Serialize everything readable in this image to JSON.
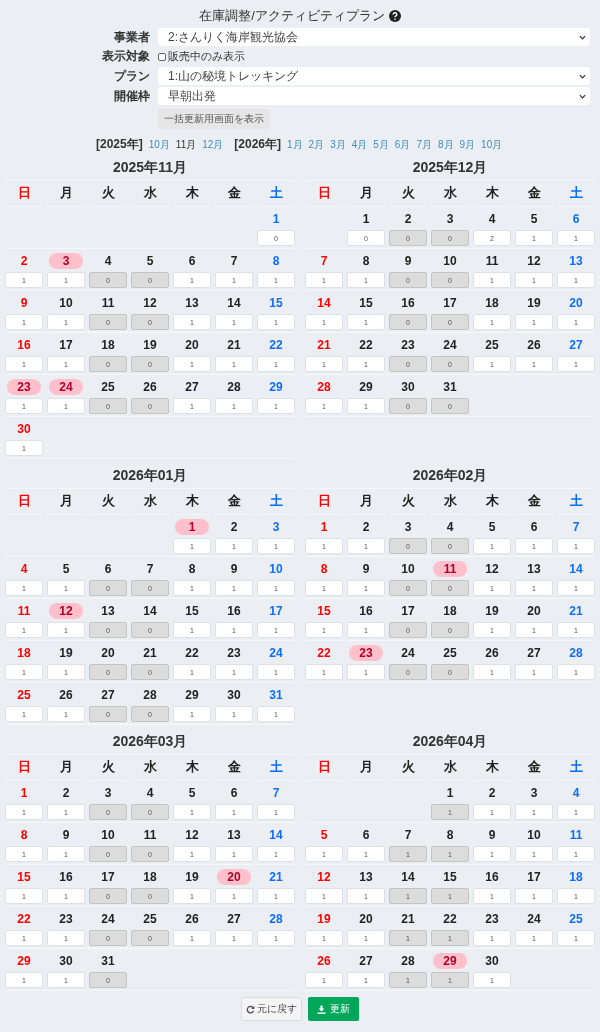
{
  "title": {
    "text": "在庫調整/アクティビティプラン"
  },
  "form": [
    {
      "kind": "select",
      "label": "事業者",
      "value": "2:さんりく海岸観光協会"
    },
    {
      "kind": "checkbox",
      "label": "表示対象",
      "text": "販売中のみ表示",
      "checked": false
    },
    {
      "kind": "select",
      "label": "プラン",
      "value": "1:山の秘境トレッキング"
    },
    {
      "kind": "select",
      "label": "開催枠",
      "value": "早朝出発"
    }
  ],
  "bulk_button": "一括更新用画面を表示",
  "year_nav": [
    {
      "year": "[2025年]",
      "months": [
        {
          "label": "10月",
          "selected": false
        },
        {
          "label": "11月",
          "selected": true
        },
        {
          "label": "12月",
          "selected": false
        }
      ]
    },
    {
      "year": "[2026年]",
      "months": [
        {
          "label": "1月",
          "selected": false
        },
        {
          "label": "2月",
          "selected": false
        },
        {
          "label": "3月",
          "selected": false
        },
        {
          "label": "4月",
          "selected": false
        },
        {
          "label": "5月",
          "selected": false
        },
        {
          "label": "6月",
          "selected": false
        },
        {
          "label": "7月",
          "selected": false
        },
        {
          "label": "8月",
          "selected": false
        },
        {
          "label": "9月",
          "selected": false
        },
        {
          "label": "10月",
          "selected": false
        }
      ]
    }
  ],
  "months": [
    {
      "title": "2025年11月",
      "weekdays": [
        "日",
        "月",
        "火",
        "水",
        "木",
        "金",
        "土"
      ],
      "weeks": [
        [
          {
            "day": "1",
            "count": "0",
            "closed": false,
            "holiday": false
          }
        ],
        [
          {
            "day": "2",
            "count": "1",
            "closed": false,
            "holiday": false
          },
          {
            "day": "3",
            "count": "1",
            "closed": false,
            "holiday": true
          },
          {
            "day": "4",
            "count": "0",
            "closed": true,
            "holiday": false
          },
          {
            "day": "5",
            "count": "0",
            "closed": true,
            "holiday": false
          },
          {
            "day": "6",
            "count": "1",
            "closed": false,
            "holiday": false
          },
          {
            "day": "7",
            "count": "1",
            "closed": false,
            "holiday": false
          },
          {
            "day": "8",
            "count": "1",
            "closed": false,
            "holiday": false
          }
        ],
        [
          {
            "day": "9",
            "count": "1",
            "closed": false,
            "holiday": false
          },
          {
            "day": "10",
            "count": "1",
            "closed": false,
            "holiday": false
          },
          {
            "day": "11",
            "count": "0",
            "closed": true,
            "holiday": false
          },
          {
            "day": "12",
            "count": "0",
            "closed": true,
            "holiday": false
          },
          {
            "day": "13",
            "count": "1",
            "closed": false,
            "holiday": false
          },
          {
            "day": "14",
            "count": "1",
            "closed": false,
            "holiday": false
          },
          {
            "day": "15",
            "count": "1",
            "closed": false,
            "holiday": false
          }
        ],
        [
          {
            "day": "16",
            "count": "1",
            "closed": false,
            "holiday": false
          },
          {
            "day": "17",
            "count": "1",
            "closed": false,
            "holiday": false
          },
          {
            "day": "18",
            "count": "0",
            "closed": true,
            "holiday": false
          },
          {
            "day": "19",
            "count": "0",
            "closed": true,
            "holiday": false
          },
          {
            "day": "20",
            "count": "1",
            "closed": false,
            "holiday": false
          },
          {
            "day": "21",
            "count": "1",
            "closed": false,
            "holiday": false
          },
          {
            "day": "22",
            "count": "1",
            "closed": false,
            "holiday": false
          }
        ],
        [
          {
            "day": "23",
            "count": "1",
            "closed": false,
            "holiday": true
          },
          {
            "day": "24",
            "count": "1",
            "closed": false,
            "holiday": true
          },
          {
            "day": "25",
            "count": "0",
            "closed": true,
            "holiday": false
          },
          {
            "day": "26",
            "count": "0",
            "closed": true,
            "holiday": false
          },
          {
            "day": "27",
            "count": "1",
            "closed": false,
            "holiday": false
          },
          {
            "day": "28",
            "count": "1",
            "closed": false,
            "holiday": false
          },
          {
            "day": "29",
            "count": "1",
            "closed": false,
            "holiday": false
          }
        ],
        [
          {
            "day": "30",
            "count": "1",
            "closed": false,
            "holiday": false
          }
        ]
      ]
    },
    {
      "title": "2025年12月",
      "weekdays": [
        "日",
        "月",
        "火",
        "水",
        "木",
        "金",
        "土"
      ],
      "weeks": [
        [
          {
            "day": "1",
            "count": "0",
            "closed": false,
            "holiday": false
          },
          {
            "day": "2",
            "count": "0",
            "closed": true,
            "holiday": false
          },
          {
            "day": "3",
            "count": "0",
            "closed": true,
            "holiday": false
          },
          {
            "day": "4",
            "count": "2",
            "closed": false,
            "holiday": false
          },
          {
            "day": "5",
            "count": "1",
            "closed": false,
            "holiday": false
          },
          {
            "day": "6",
            "count": "1",
            "closed": false,
            "holiday": false
          }
        ],
        [
          {
            "day": "7",
            "count": "1",
            "closed": false,
            "holiday": false
          },
          {
            "day": "8",
            "count": "1",
            "closed": false,
            "holiday": false
          },
          {
            "day": "9",
            "count": "0",
            "closed": true,
            "holiday": false
          },
          {
            "day": "10",
            "count": "0",
            "closed": true,
            "holiday": false
          },
          {
            "day": "11",
            "count": "1",
            "closed": false,
            "holiday": false
          },
          {
            "day": "12",
            "count": "1",
            "closed": false,
            "holiday": false
          },
          {
            "day": "13",
            "count": "1",
            "closed": false,
            "holiday": false
          }
        ],
        [
          {
            "day": "14",
            "count": "1",
            "closed": false,
            "holiday": false
          },
          {
            "day": "15",
            "count": "1",
            "closed": false,
            "holiday": false
          },
          {
            "day": "16",
            "count": "0",
            "closed": true,
            "holiday": false
          },
          {
            "day": "17",
            "count": "0",
            "closed": true,
            "holiday": false
          },
          {
            "day": "18",
            "count": "1",
            "closed": false,
            "holiday": false
          },
          {
            "day": "19",
            "count": "1",
            "closed": false,
            "holiday": false
          },
          {
            "day": "20",
            "count": "1",
            "closed": false,
            "holiday": false
          }
        ],
        [
          {
            "day": "21",
            "count": "1",
            "closed": false,
            "holiday": false
          },
          {
            "day": "22",
            "count": "1",
            "closed": false,
            "holiday": false
          },
          {
            "day": "23",
            "count": "0",
            "closed": true,
            "holiday": false
          },
          {
            "day": "24",
            "count": "0",
            "closed": true,
            "holiday": false
          },
          {
            "day": "25",
            "count": "1",
            "closed": false,
            "holiday": false
          },
          {
            "day": "26",
            "count": "1",
            "closed": false,
            "holiday": false
          },
          {
            "day": "27",
            "count": "1",
            "closed": false,
            "holiday": false
          }
        ],
        [
          {
            "day": "28",
            "count": "1",
            "closed": false,
            "holiday": false
          },
          {
            "day": "29",
            "count": "1",
            "closed": false,
            "holiday": false
          },
          {
            "day": "30",
            "count": "0",
            "closed": true,
            "holiday": false
          },
          {
            "day": "31",
            "count": "0",
            "closed": true,
            "holiday": false
          }
        ]
      ]
    },
    {
      "title": "2026年01月",
      "weekdays": [
        "日",
        "月",
        "火",
        "水",
        "木",
        "金",
        "土"
      ],
      "weeks": [
        [
          {
            "day": "1",
            "count": "1",
            "closed": false,
            "holiday": true
          },
          {
            "day": "2",
            "count": "1",
            "closed": false,
            "holiday": false
          },
          {
            "day": "3",
            "count": "1",
            "closed": false,
            "holiday": false
          }
        ],
        [
          {
            "day": "4",
            "count": "1",
            "closed": false,
            "holiday": false
          },
          {
            "day": "5",
            "count": "1",
            "closed": false,
            "holiday": false
          },
          {
            "day": "6",
            "count": "0",
            "closed": true,
            "holiday": false
          },
          {
            "day": "7",
            "count": "0",
            "closed": true,
            "holiday": false
          },
          {
            "day": "8",
            "count": "1",
            "closed": false,
            "holiday": false
          },
          {
            "day": "9",
            "count": "1",
            "closed": false,
            "holiday": false
          },
          {
            "day": "10",
            "count": "1",
            "closed": false,
            "holiday": false
          }
        ],
        [
          {
            "day": "11",
            "count": "1",
            "closed": false,
            "holiday": false
          },
          {
            "day": "12",
            "count": "1",
            "closed": false,
            "holiday": true
          },
          {
            "day": "13",
            "count": "0",
            "closed": true,
            "holiday": false
          },
          {
            "day": "14",
            "count": "0",
            "closed": true,
            "holiday": false
          },
          {
            "day": "15",
            "count": "1",
            "closed": false,
            "holiday": false
          },
          {
            "day": "16",
            "count": "1",
            "closed": false,
            "holiday": false
          },
          {
            "day": "17",
            "count": "1",
            "closed": false,
            "holiday": false
          }
        ],
        [
          {
            "day": "18",
            "count": "1",
            "closed": false,
            "holiday": false
          },
          {
            "day": "19",
            "count": "1",
            "closed": false,
            "holiday": false
          },
          {
            "day": "20",
            "count": "0",
            "closed": true,
            "holiday": false
          },
          {
            "day": "21",
            "count": "0",
            "closed": true,
            "holiday": false
          },
          {
            "day": "22",
            "count": "1",
            "closed": false,
            "holiday": false
          },
          {
            "day": "23",
            "count": "1",
            "closed": false,
            "holiday": false
          },
          {
            "day": "24",
            "count": "1",
            "closed": false,
            "holiday": false
          }
        ],
        [
          {
            "day": "25",
            "count": "1",
            "closed": false,
            "holiday": false
          },
          {
            "day": "26",
            "count": "1",
            "closed": false,
            "holiday": false
          },
          {
            "day": "27",
            "count": "0",
            "closed": true,
            "holiday": false
          },
          {
            "day": "28",
            "count": "0",
            "closed": true,
            "holiday": false
          },
          {
            "day": "29",
            "count": "1",
            "closed": false,
            "holiday": false
          },
          {
            "day": "30",
            "count": "1",
            "closed": false,
            "holiday": false
          },
          {
            "day": "31",
            "count": "1",
            "closed": false,
            "holiday": false
          }
        ]
      ]
    },
    {
      "title": "2026年02月",
      "weekdays": [
        "日",
        "月",
        "火",
        "水",
        "木",
        "金",
        "土"
      ],
      "weeks": [
        [
          {
            "day": "1",
            "count": "1",
            "closed": false,
            "holiday": false
          },
          {
            "day": "2",
            "count": "1",
            "closed": false,
            "holiday": false
          },
          {
            "day": "3",
            "count": "0",
            "closed": true,
            "holiday": false
          },
          {
            "day": "4",
            "count": "0",
            "closed": true,
            "holiday": false
          },
          {
            "day": "5",
            "count": "1",
            "closed": false,
            "holiday": false
          },
          {
            "day": "6",
            "count": "1",
            "closed": false,
            "holiday": false
          },
          {
            "day": "7",
            "count": "1",
            "closed": false,
            "holiday": false
          }
        ],
        [
          {
            "day": "8",
            "count": "1",
            "closed": false,
            "holiday": false
          },
          {
            "day": "9",
            "count": "1",
            "closed": false,
            "holiday": false
          },
          {
            "day": "10",
            "count": "0",
            "closed": true,
            "holiday": false
          },
          {
            "day": "11",
            "count": "0",
            "closed": true,
            "holiday": true
          },
          {
            "day": "12",
            "count": "1",
            "closed": false,
            "holiday": false
          },
          {
            "day": "13",
            "count": "1",
            "closed": false,
            "holiday": false
          },
          {
            "day": "14",
            "count": "1",
            "closed": false,
            "holiday": false
          }
        ],
        [
          {
            "day": "15",
            "count": "1",
            "closed": false,
            "holiday": false
          },
          {
            "day": "16",
            "count": "1",
            "closed": false,
            "holiday": false
          },
          {
            "day": "17",
            "count": "0",
            "closed": true,
            "holiday": false
          },
          {
            "day": "18",
            "count": "0",
            "closed": true,
            "holiday": false
          },
          {
            "day": "19",
            "count": "1",
            "closed": false,
            "holiday": false
          },
          {
            "day": "20",
            "count": "1",
            "closed": false,
            "holiday": false
          },
          {
            "day": "21",
            "count": "1",
            "closed": false,
            "holiday": false
          }
        ],
        [
          {
            "day": "22",
            "count": "1",
            "closed": false,
            "holiday": false
          },
          {
            "day": "23",
            "count": "1",
            "closed": false,
            "holiday": true
          },
          {
            "day": "24",
            "count": "0",
            "closed": true,
            "holiday": false
          },
          {
            "day": "25",
            "count": "0",
            "closed": true,
            "holiday": false
          },
          {
            "day": "26",
            "count": "1",
            "closed": false,
            "holiday": false
          },
          {
            "day": "27",
            "count": "1",
            "closed": false,
            "holiday": false
          },
          {
            "day": "28",
            "count": "1",
            "closed": false,
            "holiday": false
          }
        ]
      ]
    },
    {
      "title": "2026年03月",
      "weekdays": [
        "日",
        "月",
        "火",
        "水",
        "木",
        "金",
        "土"
      ],
      "weeks": [
        [
          {
            "day": "1",
            "count": "1",
            "closed": false,
            "holiday": false
          },
          {
            "day": "2",
            "count": "1",
            "closed": false,
            "holiday": false
          },
          {
            "day": "3",
            "count": "0",
            "closed": true,
            "holiday": false
          },
          {
            "day": "4",
            "count": "0",
            "closed": true,
            "holiday": false
          },
          {
            "day": "5",
            "count": "1",
            "closed": false,
            "holiday": false
          },
          {
            "day": "6",
            "count": "1",
            "closed": false,
            "holiday": false
          },
          {
            "day": "7",
            "count": "1",
            "closed": false,
            "holiday": false
          }
        ],
        [
          {
            "day": "8",
            "count": "1",
            "closed": false,
            "holiday": false
          },
          {
            "day": "9",
            "count": "1",
            "closed": false,
            "holiday": false
          },
          {
            "day": "10",
            "count": "0",
            "closed": true,
            "holiday": false
          },
          {
            "day": "11",
            "count": "0",
            "closed": true,
            "holiday": false
          },
          {
            "day": "12",
            "count": "1",
            "closed": false,
            "holiday": false
          },
          {
            "day": "13",
            "count": "1",
            "closed": false,
            "holiday": false
          },
          {
            "day": "14",
            "count": "1",
            "closed": false,
            "holiday": false
          }
        ],
        [
          {
            "day": "15",
            "count": "1",
            "closed": false,
            "holiday": false
          },
          {
            "day": "16",
            "count": "1",
            "closed": false,
            "holiday": false
          },
          {
            "day": "17",
            "count": "0",
            "closed": true,
            "holiday": false
          },
          {
            "day": "18",
            "count": "0",
            "closed": true,
            "holiday": false
          },
          {
            "day": "19",
            "count": "1",
            "closed": false,
            "holiday": false
          },
          {
            "day": "20",
            "count": "1",
            "closed": false,
            "holiday": true
          },
          {
            "day": "21",
            "count": "1",
            "closed": false,
            "holiday": false
          }
        ],
        [
          {
            "day": "22",
            "count": "1",
            "closed": false,
            "holiday": false
          },
          {
            "day": "23",
            "count": "1",
            "closed": false,
            "holiday": false
          },
          {
            "day": "24",
            "count": "0",
            "closed": true,
            "holiday": false
          },
          {
            "day": "25",
            "count": "0",
            "closed": true,
            "holiday": false
          },
          {
            "day": "26",
            "count": "1",
            "closed": false,
            "holiday": false
          },
          {
            "day": "27",
            "count": "1",
            "closed": false,
            "holiday": false
          },
          {
            "day": "28",
            "count": "1",
            "closed": false,
            "holiday": false
          }
        ],
        [
          {
            "day": "29",
            "count": "1",
            "closed": false,
            "holiday": false
          },
          {
            "day": "30",
            "count": "1",
            "closed": false,
            "holiday": false
          },
          {
            "day": "31",
            "count": "0",
            "closed": true,
            "holiday": false
          }
        ]
      ]
    },
    {
      "title": "2026年04月",
      "weekdays": [
        "日",
        "月",
        "火",
        "水",
        "木",
        "金",
        "土"
      ],
      "weeks": [
        [
          {
            "day": "1",
            "count": "1",
            "closed": true,
            "holiday": false
          },
          {
            "day": "2",
            "count": "1",
            "closed": false,
            "holiday": false
          },
          {
            "day": "3",
            "count": "1",
            "closed": false,
            "holiday": false
          },
          {
            "day": "4",
            "count": "1",
            "closed": false,
            "holiday": false
          }
        ],
        [
          {
            "day": "5",
            "count": "1",
            "closed": false,
            "holiday": false
          },
          {
            "day": "6",
            "count": "1",
            "closed": false,
            "holiday": false
          },
          {
            "day": "7",
            "count": "1",
            "closed": true,
            "holiday": false
          },
          {
            "day": "8",
            "count": "1",
            "closed": true,
            "holiday": false
          },
          {
            "day": "9",
            "count": "1",
            "closed": false,
            "holiday": false
          },
          {
            "day": "10",
            "count": "1",
            "closed": false,
            "holiday": false
          },
          {
            "day": "11",
            "count": "1",
            "closed": false,
            "holiday": false
          }
        ],
        [
          {
            "day": "12",
            "count": "1",
            "closed": false,
            "holiday": false
          },
          {
            "day": "13",
            "count": "1",
            "closed": false,
            "holiday": false
          },
          {
            "day": "14",
            "count": "1",
            "closed": true,
            "holiday": false
          },
          {
            "day": "15",
            "count": "1",
            "closed": true,
            "holiday": false
          },
          {
            "day": "16",
            "count": "1",
            "closed": false,
            "holiday": false
          },
          {
            "day": "17",
            "count": "1",
            "closed": false,
            "holiday": false
          },
          {
            "day": "18",
            "count": "1",
            "closed": false,
            "holiday": false
          }
        ],
        [
          {
            "day": "19",
            "count": "1",
            "closed": false,
            "holiday": false
          },
          {
            "day": "20",
            "count": "1",
            "closed": false,
            "holiday": false
          },
          {
            "day": "21",
            "count": "1",
            "closed": true,
            "holiday": false
          },
          {
            "day": "22",
            "count": "1",
            "closed": true,
            "holiday": false
          },
          {
            "day": "23",
            "count": "1",
            "closed": false,
            "holiday": false
          },
          {
            "day": "24",
            "count": "1",
            "closed": false,
            "holiday": false
          },
          {
            "day": "25",
            "count": "1",
            "closed": false,
            "holiday": false
          }
        ],
        [
          {
            "day": "26",
            "count": "1",
            "closed": false,
            "holiday": false
          },
          {
            "day": "27",
            "count": "1",
            "closed": false,
            "holiday": false
          },
          {
            "day": "28",
            "count": "1",
            "closed": true,
            "holiday": false
          },
          {
            "day": "29",
            "count": "1",
            "closed": true,
            "holiday": true
          },
          {
            "day": "30",
            "count": "1",
            "closed": false,
            "holiday": false
          }
        ]
      ]
    }
  ],
  "buttons": [
    {
      "kind": "reset",
      "label": "元に戻す"
    },
    {
      "kind": "update",
      "label": "更新"
    }
  ]
}
